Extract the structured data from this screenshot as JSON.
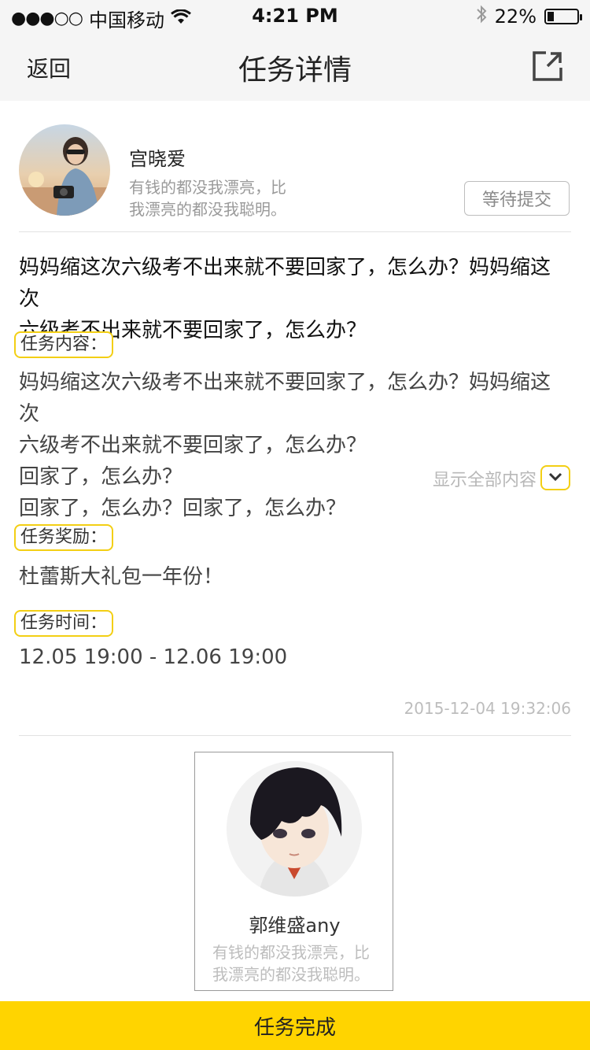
{
  "status_bar": {
    "signal": "●●●○○",
    "carrier": "中国移动",
    "time": "4:21 PM",
    "battery_percent": "22%",
    "battery_level": 0.22
  },
  "nav": {
    "back_label": "返回",
    "title": "任务详情"
  },
  "publisher": {
    "name": "宫晓爱",
    "bio_line1": "有钱的都没我漂亮，比",
    "bio_line2": "我漂亮的都没我聪明。",
    "status_label": "等待提交"
  },
  "task": {
    "title_line1": "妈妈缩这次六级考不出来就不要回家了，怎么办？妈妈缩这次",
    "title_line2": "六级考不出来就不要回家了，怎么办？",
    "content_label": "任务内容：",
    "content_lines": [
      "妈妈缩这次六级考不出来就不要回家了，怎么办？妈妈缩这次",
      "六级考不出来就不要回家了，怎么办？",
      "回家了，怎么办？",
      "回家了，怎么办？回家了，怎么办？"
    ],
    "show_all_label": "显示全部内容",
    "reward_label": "任务奖励：",
    "reward_text": "杜蕾斯大礼包一年份！",
    "time_label": "任务时间：",
    "time_text": "12.05 19:00 - 12.06 19:00",
    "created_at": "2015-12-04   19:32:06"
  },
  "performer": {
    "name": "郭维盛any",
    "bio_line1": "有钱的都没我漂亮，比",
    "bio_line2": "我漂亮的都没我聪明。"
  },
  "bottom": {
    "complete_label": "任务完成"
  },
  "colors": {
    "accent_yellow": "#ffd400",
    "label_border": "#f3cf14"
  }
}
